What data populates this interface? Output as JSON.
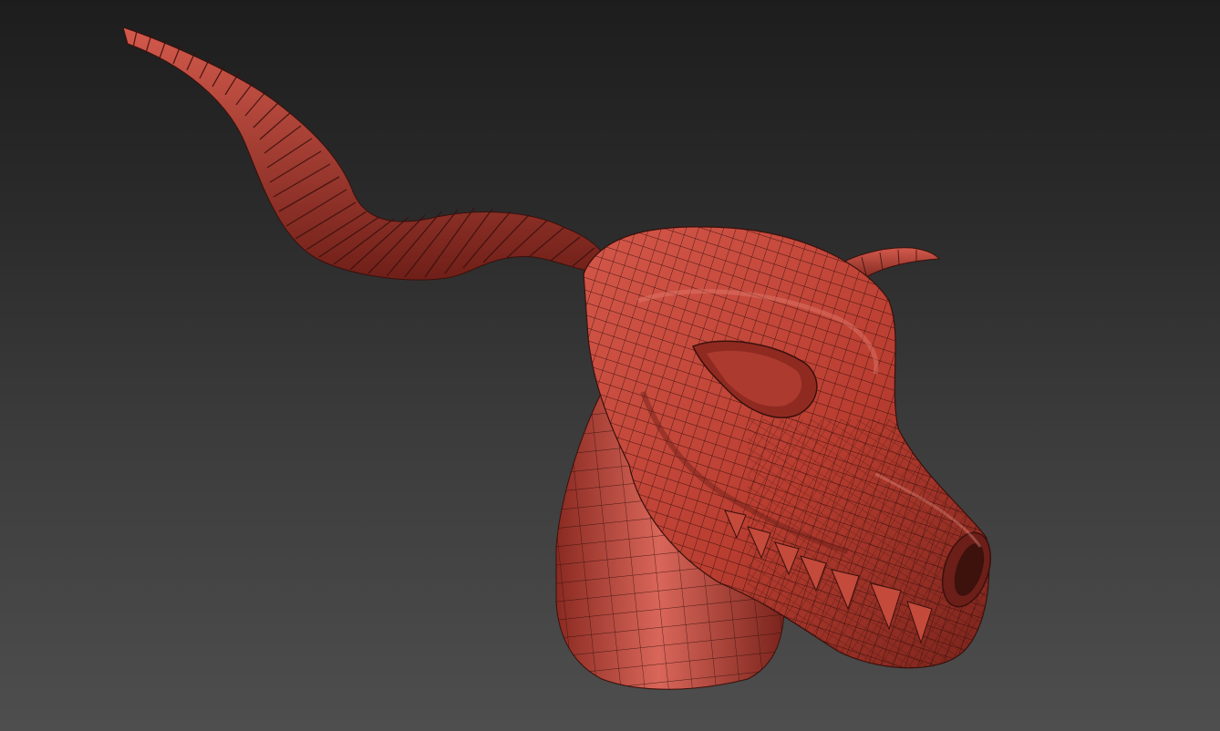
{
  "viewport": {
    "background_top_color": "#1d1d1d",
    "background_bottom_color": "#4e4e4e"
  },
  "model": {
    "subject": "dragon-skull-with-horns",
    "display_mode": "wireframe-on-shaded",
    "surface_color": "#c2483a",
    "surface_highlight_color": "#e0766a",
    "surface_shadow_color": "#6b1f18",
    "wire_color": "#2a0c08"
  }
}
